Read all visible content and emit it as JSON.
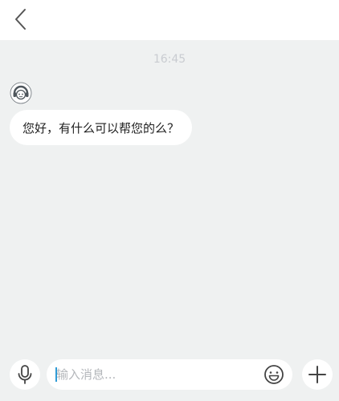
{
  "header": {
    "back_icon": "chevron-left-icon"
  },
  "chat": {
    "timestamp": "16:45",
    "messages": [
      {
        "sender": "agent",
        "avatar_icon": "support-agent-avatar-icon",
        "text": "您好，有什么可以帮您的么？"
      }
    ]
  },
  "composer": {
    "mic_icon": "microphone-icon",
    "input_value": "",
    "input_placeholder": "输入消息...",
    "emoji_icon": "smiley-face-icon",
    "plus_icon": "plus-icon"
  },
  "colors": {
    "chat_background": "#eff1f1",
    "bubble_background": "#ffffff",
    "timestamp": "#c9ccd1",
    "caret": "#2f9bd6"
  }
}
